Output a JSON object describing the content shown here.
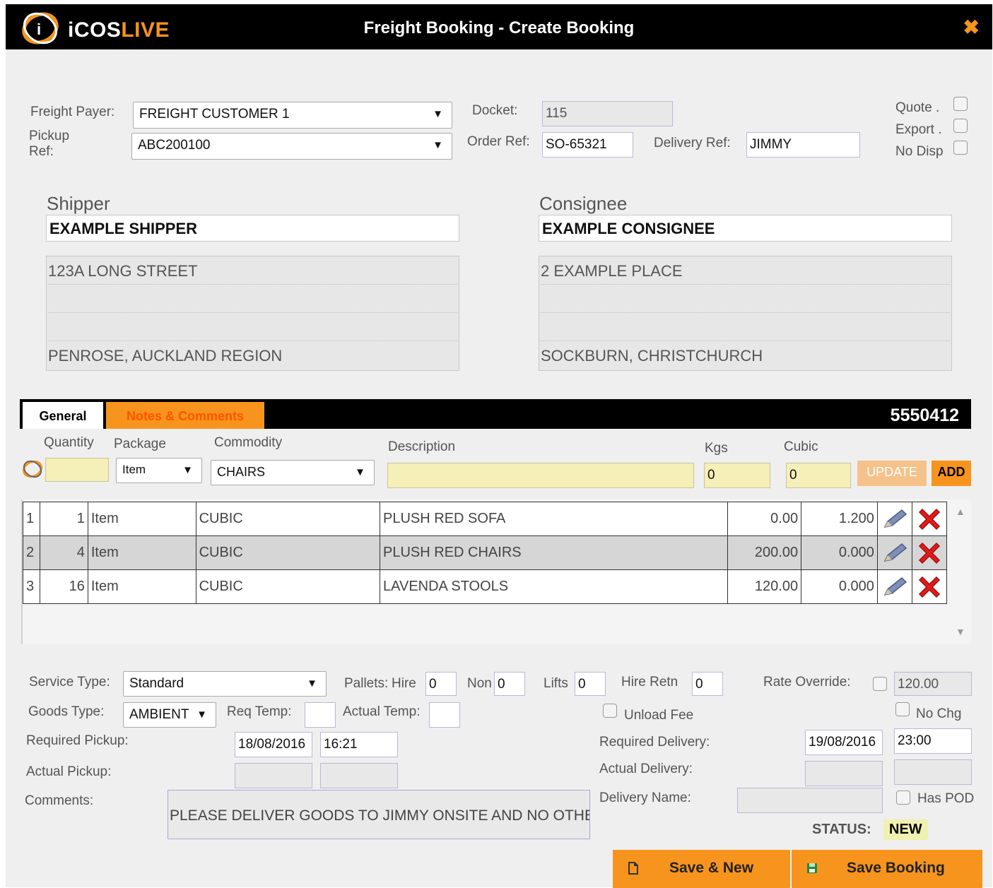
{
  "window": {
    "logo_prefix": "iCOS",
    "logo_suffix": "LIVE",
    "title": "Freight Booking - Create Booking",
    "close_icon": "close-icon"
  },
  "header": {
    "freight_payer_label": "Freight Payer:",
    "freight_payer_value": "FREIGHT CUSTOMER 1",
    "pickup_ref_label_1": "Pickup",
    "pickup_ref_label_2": "Ref:",
    "pickup_ref_value": "ABC200100",
    "docket_label": "Docket:",
    "docket_value": "115",
    "order_ref_label": "Order Ref:",
    "order_ref_value": "SO-65321",
    "delivery_ref_label": "Delivery Ref:",
    "delivery_ref_value": "JIMMY",
    "quote_label": "Quote .",
    "export_label": "Export .",
    "no_disp_label": "No Disp"
  },
  "shipper": {
    "title": "Shipper",
    "name": "EXAMPLE SHIPPER",
    "address": [
      "123A LONG STREET",
      "",
      "",
      "PENROSE, AUCKLAND REGION"
    ]
  },
  "consignee": {
    "title": "Consignee",
    "name": "EXAMPLE CONSIGNEE",
    "address": [
      "2 EXAMPLE PLACE",
      "",
      "",
      "SOCKBURN, CHRISTCHURCH"
    ]
  },
  "tabs": {
    "general": "General",
    "notes": "Notes & Comments",
    "booking_number": "5550412"
  },
  "item_entry": {
    "quantity_label": "Quantity",
    "package_label": "Package",
    "commodity_label": "Commodity",
    "description_label": "Description",
    "kgs_label": "Kgs",
    "cubic_label": "Cubic",
    "quantity_value": "",
    "package_value": "Item",
    "commodity_value": "CHAIRS",
    "description_value": "",
    "kgs_value": "0",
    "cubic_value": "0",
    "update_label": "UPDATE",
    "add_label": "ADD"
  },
  "items": [
    {
      "row": "1",
      "qty": "1",
      "package": "Item",
      "commodity": "CUBIC",
      "description": "PLUSH RED SOFA",
      "kgs": "0.00",
      "cubic": "1.200"
    },
    {
      "row": "2",
      "qty": "4",
      "package": "Item",
      "commodity": "CUBIC",
      "description": "PLUSH RED CHAIRS",
      "kgs": "200.00",
      "cubic": "0.000"
    },
    {
      "row": "3",
      "qty": "16",
      "package": "Item",
      "commodity": "CUBIC",
      "description": "LAVENDA STOOLS",
      "kgs": "120.00",
      "cubic": "0.000"
    }
  ],
  "details": {
    "service_type_label": "Service Type:",
    "service_type_value": "Standard",
    "pallets_label": "Pallets:",
    "hire_label": "Hire",
    "hire_value": "0",
    "non_label": "Non",
    "non_value": "0",
    "lifts_label": "Lifts",
    "lifts_value": "0",
    "hire_retn_label": "Hire Retn",
    "hire_retn_value": "0",
    "rate_override_label": "Rate Override:",
    "rate_override_value": "120.00",
    "goods_type_label": "Goods Type:",
    "goods_type_value": "AMBIENT",
    "req_temp_label": "Req Temp:",
    "req_temp_value": "",
    "actual_temp_label": "Actual Temp:",
    "actual_temp_value": "",
    "unload_fee_label": "Unload Fee",
    "no_chg_label": "No Chg",
    "required_pickup_label": "Required Pickup:",
    "required_pickup_date": "18/08/2016",
    "required_pickup_time": "16:21",
    "required_delivery_label": "Required Delivery:",
    "required_delivery_date": "19/08/2016",
    "required_delivery_time": "23:00",
    "actual_pickup_label": "Actual Pickup:",
    "actual_delivery_label": "Actual Delivery:",
    "comments_label": "Comments:",
    "comments_value": "PLEASE DELIVER GOODS TO JIMMY ONSITE AND NO OTHE",
    "delivery_name_label": "Delivery Name:",
    "has_pod_label": "Has POD",
    "status_label": "STATUS:",
    "status_value": "NEW"
  },
  "actions": {
    "save_new_label": "Save & New",
    "save_booking_label": "Save Booking"
  },
  "colors": {
    "accent": "#f7941d",
    "titlebar": "#000000",
    "background": "#efefef",
    "delete_red": "#e21b1b"
  }
}
